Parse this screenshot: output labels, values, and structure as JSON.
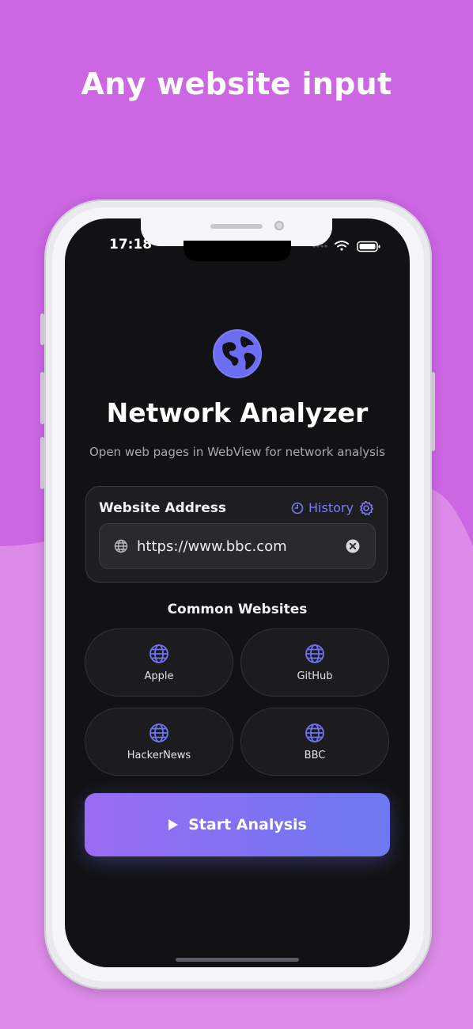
{
  "headline": "Any website input",
  "colors": {
    "background": "#cc66e3",
    "background_lower": "#dc8be8",
    "accent": "#7d79f4",
    "screen": "#121214"
  },
  "status_bar": {
    "time": "17:18",
    "icons": [
      "signal-icon",
      "wifi-icon",
      "battery-icon"
    ]
  },
  "app": {
    "logo_icon": "globe-icon",
    "title": "Network Analyzer",
    "subtitle": "Open web pages in WebView for network analysis"
  },
  "address_card": {
    "label": "Website Address",
    "history_label": "History",
    "history_icon": "clock-icon",
    "settings_icon": "gear-icon",
    "url_value": "https://www.bbc.com",
    "url_icon": "globe-icon",
    "clear_icon": "clear-icon"
  },
  "common_sites": {
    "title": "Common Websites",
    "items": [
      {
        "label": "Apple",
        "icon": "globe-icon"
      },
      {
        "label": "GitHub",
        "icon": "globe-icon"
      },
      {
        "label": "HackerNews",
        "icon": "globe-icon"
      },
      {
        "label": "BBC",
        "icon": "globe-icon"
      }
    ]
  },
  "start_button": {
    "label": "Start Analysis",
    "icon": "play-icon"
  }
}
